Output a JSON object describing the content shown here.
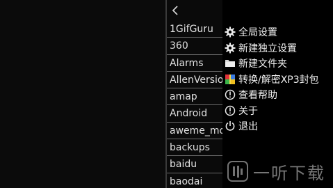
{
  "file_list": {
    "items": [
      {
        "label": "1GifGuru"
      },
      {
        "label": "360"
      },
      {
        "label": "Alarms"
      },
      {
        "label": "AllenVersion"
      },
      {
        "label": "amap"
      },
      {
        "label": "Android"
      },
      {
        "label": "aweme_monitor"
      },
      {
        "label": "backups"
      },
      {
        "label": "baidu"
      },
      {
        "label": "baodai"
      }
    ]
  },
  "menu": {
    "items": [
      {
        "label": "全局设置",
        "icon": "gear-icon"
      },
      {
        "label": "新建独立设置",
        "icon": "gear-icon"
      },
      {
        "label": "新建文件夹",
        "icon": "folder-icon"
      },
      {
        "label": "转换/解密XP3封包",
        "icon": "package-icon"
      },
      {
        "label": "查看帮助",
        "icon": "info-icon"
      },
      {
        "label": "关于",
        "icon": "info-icon"
      },
      {
        "label": "退出",
        "icon": "power-icon"
      }
    ]
  },
  "watermark": {
    "text": "一听下载"
  },
  "colors": {
    "background": "#000000",
    "divider": "#3a3a3a",
    "row_border": "#6a6a6a",
    "text": "#e6e6e6"
  }
}
